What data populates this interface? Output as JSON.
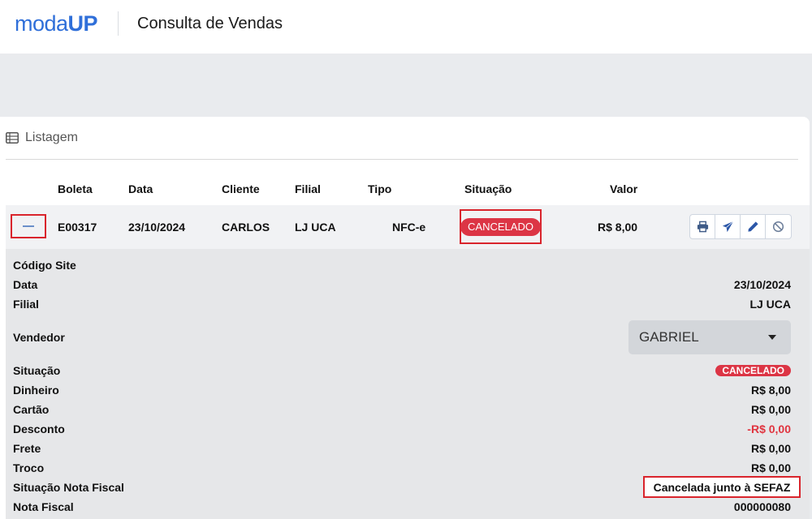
{
  "app": {
    "logo_light": "moda",
    "logo_bold": "UP",
    "page_title": "Consulta de Vendas",
    "brand_color": "#2f6fd9"
  },
  "listing": {
    "header": "Listagem",
    "header_icon": "list-table-icon",
    "columns": {
      "boleta": "Boleta",
      "data": "Data",
      "cliente": "Cliente",
      "filial": "Filial",
      "tipo": "Tipo",
      "situacao": "Situação",
      "valor": "Valor"
    },
    "row": {
      "toggle_icon": "minus-icon",
      "boleta": "E00317",
      "data": "23/10/2024",
      "cliente": "CARLOS",
      "filial": "LJ UCA",
      "tipo": "NFC-e",
      "situacao": "CANCELADO",
      "valor": "R$ 8,00",
      "actions": [
        "printer-icon",
        "paper-plane-icon",
        "pencil-icon",
        "ban-icon"
      ]
    }
  },
  "details": {
    "codigo_site": {
      "label": "Código Site",
      "value": ""
    },
    "data": {
      "label": "Data",
      "value": "23/10/2024"
    },
    "filial": {
      "label": "Filial",
      "value": "LJ UCA"
    },
    "vendedor": {
      "label": "Vendedor",
      "value": "GABRIEL"
    },
    "situacao": {
      "label": "Situação",
      "value": "CANCELADO"
    },
    "dinheiro": {
      "label": "Dinheiro",
      "value": "R$ 8,00"
    },
    "cartao": {
      "label": "Cartão",
      "value": "R$ 0,00"
    },
    "desconto": {
      "label": "Desconto",
      "value": "-R$ 0,00"
    },
    "frete": {
      "label": "Frete",
      "value": "R$ 0,00"
    },
    "troco": {
      "label": "Troco",
      "value": "R$ 0,00"
    },
    "situacao_nf": {
      "label": "Situação Nota Fiscal",
      "value": "Cancelada junto à SEFAZ"
    },
    "nota_fiscal": {
      "label": "Nota Fiscal",
      "value": "000000080"
    }
  },
  "colors": {
    "danger": "#dc3545",
    "highlight_border": "#d9242c",
    "negative_value": "#e0343f"
  }
}
